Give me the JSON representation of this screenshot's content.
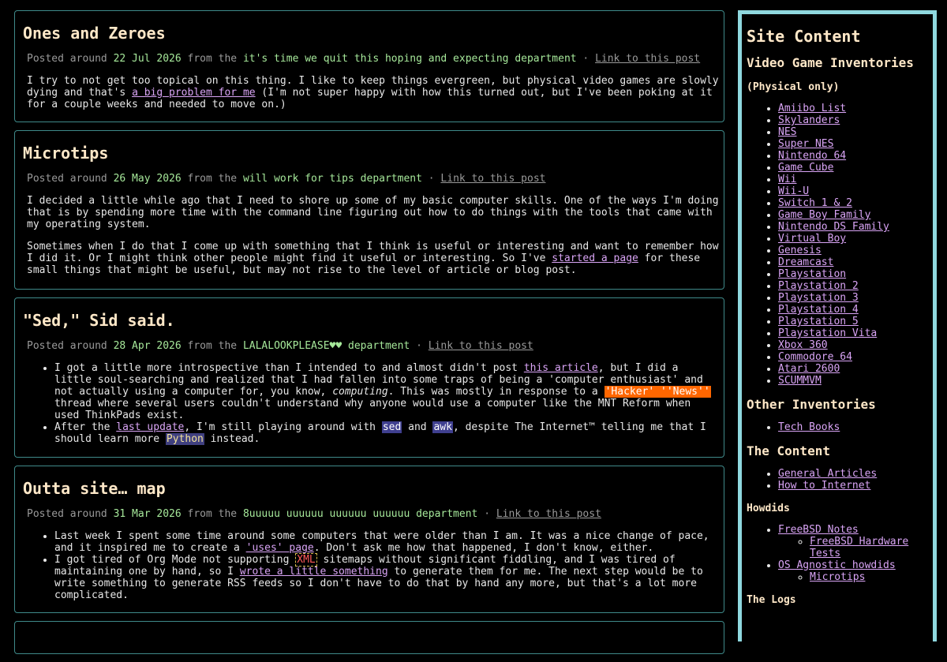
{
  "colors": {
    "background": "#000000",
    "text": "#e8e8e8",
    "heading": "#ffe8c8",
    "link": "#d9a4f5",
    "meta": "#9a9a9a",
    "meta_accent": "#a6e89a",
    "border": "#3f8a8a",
    "sidebar_border": "#8fd8df"
  },
  "posts": [
    {
      "title": "Ones and Zeroes",
      "meta": {
        "posted": "Posted around",
        "date": "22 Jul 2026",
        "from": "from the",
        "dept": "it's time we quit this hoping and expecting department",
        "sep": "·",
        "link": "Link to this post"
      },
      "p1": {
        "a": "I try to not get too topical on this thing. I like to keep things evergreen, but physical video games are slowly dying and that's ",
        "link": "a big problem for me",
        "b": " (I'm not super happy with how this turned out, but I've been poking at it for a couple weeks and needed to move on.)"
      }
    },
    {
      "title": "Microtips",
      "meta": {
        "posted": "Posted around",
        "date": "26 May 2026",
        "from": "from the",
        "dept": "will work for tips department",
        "sep": "·",
        "link": "Link to this post"
      },
      "p1": "I decided a little while ago that I need to shore up some of my basic computer skills. One of the ways I'm doing that is by spending more time with the command line figuring out how to do things with the tools that came with my operating system.",
      "p2": {
        "a": "Sometimes when I do that I come up with something that I think is useful or interesting and want to remember how I did it. Or I might think other people might find it useful or interesting. So I've ",
        "link": "started a page",
        "b": " for these small things that might be useful, but may not rise to the level of article or blog post."
      }
    },
    {
      "title": "\"Sed,\" Sid said.",
      "meta": {
        "posted": "Posted around",
        "date": "28 Apr 2026",
        "from": "from the",
        "dept": "LALALOOKPLEASE♥♥ department",
        "sep": "·",
        "link": "Link to this post"
      },
      "li1": {
        "a": "I got a little more introspective than I intended to and almost didn't post ",
        "link": "this article",
        "b": ", but I did a little soul-searching and realized that I had fallen into some traps of being a 'computer enthusiast' and not actually using a computer for, you know, ",
        "em": "computing",
        "c": ". This was mostly in response to a ",
        "hl": "'Hacker' ''News''",
        "d": " thread where several users couldn't understand why anyone would use a computer like the MNT Reform when used ThinkPads exist."
      },
      "li2": {
        "a": "After the ",
        "link": "last update",
        "b": ", I'm still playing around with ",
        "sed": "sed",
        "c": " and ",
        "awk": "awk",
        "d": ", despite The Internet™ telling me that I should learn more ",
        "py": "Python",
        "e": " instead."
      }
    },
    {
      "title": "Outta site… map",
      "meta": {
        "posted": "Posted around",
        "date": "31 Mar 2026",
        "from": "from the",
        "dept": "8uuuuu uuuuuu uuuuuu uuuuuu department",
        "sep": "·",
        "link": "Link to this post"
      },
      "li1": {
        "a": "Last week I spent some time around some computers that were older than I am. It was a nice change of pace, and it inspired me to create a ",
        "link": "'uses' page",
        "b": ". Don't ask me how that happened, I don't know, either."
      },
      "li2": {
        "a": "I got tired of Org Mode not supporting ",
        "xml": "XML",
        "b": " sitemaps without significant fiddling, and I was tired of maintaining one by hand, so I ",
        "link": "wrote a little something",
        "c": " to generate them for me. The next step would be to write something to generate RSS feeds so I don't have to do that by hand any more, but that's a lot more complicated."
      }
    }
  ],
  "sidebar": {
    "title": "Site Content",
    "vg_title": "Video Game Inventories",
    "vg_sub": "(Physical only)",
    "vg_items": [
      "Amiibo List",
      "Skylanders",
      "NES",
      "Super NES",
      "Nintendo 64",
      "Game Cube",
      "Wii",
      "Wii-U",
      "Switch 1 & 2",
      "Game Boy Family",
      "Nintendo DS Family",
      "Virtual Boy",
      "Genesis",
      "Dreamcast",
      "Playstation",
      "Playstation 2",
      "Playstation 3",
      "Playstation 4",
      "Playstation 5",
      "Playstation Vita",
      "Xbox 360",
      "Commodore 64",
      "Atari 2600",
      "SCUMMVM"
    ],
    "other_title": "Other Inventories",
    "other_items": [
      "Tech Books"
    ],
    "content_title": "The Content",
    "content_items": [
      "General Articles",
      "How to Internet"
    ],
    "howdids_title": "Howdids",
    "howdids": {
      "freebsd": "FreeBSD Notes",
      "freebsd_sub": "FreeBSD Hardware Tests",
      "os": "OS Agnostic howdids",
      "os_sub": "Microtips"
    },
    "logs_title": "The Logs"
  }
}
